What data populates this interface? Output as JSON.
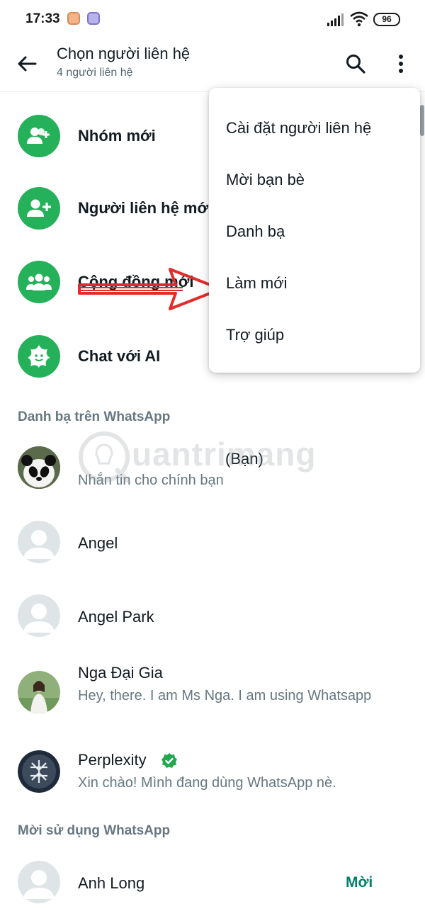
{
  "status_bar": {
    "time": "17:33",
    "battery": "96",
    "notification_icons": [
      "notification-app-icon",
      "viber-icon"
    ]
  },
  "header": {
    "title": "Chọn người liên hệ",
    "subtitle": "4 người liên hệ"
  },
  "actions": [
    {
      "label": "Nhóm mới",
      "icon": "new-group-icon"
    },
    {
      "label": "Người liên hệ mới",
      "icon": "add-contact-icon"
    },
    {
      "label": "Cộng đồng mới",
      "icon": "community-icon"
    },
    {
      "label": "Chat với AI",
      "icon": "ai-chat-icon"
    }
  ],
  "sections": {
    "whatsapp_contacts": "Danh bạ trên WhatsApp",
    "invite": "Mời sử dụng WhatsApp"
  },
  "contacts": [
    {
      "name": "(Bạn)",
      "status": "Nhắn tin cho chính bạn",
      "avatar": "panda-photo"
    },
    {
      "name": "Angel",
      "status": "",
      "avatar": "default"
    },
    {
      "name": "Angel Park",
      "status": "",
      "avatar": "default"
    },
    {
      "name": "Nga Đại Gia",
      "status": "Hey, there. I am Ms Nga. I am using Whatsapp",
      "avatar": "profile-photo"
    },
    {
      "name": "Perplexity",
      "status": "Xin chào! Mình đang dùng WhatsApp nè.",
      "avatar": "perplexity-logo",
      "verified": true
    }
  ],
  "invite_contacts": [
    {
      "name": "Anh Long",
      "action": "Mời"
    }
  ],
  "menu": {
    "items": [
      "Cài đặt người liên hệ",
      "Mời bạn bè",
      "Danh bạ",
      "Làm mới",
      "Trợ giúp"
    ]
  },
  "watermark": "uantrimang",
  "colors": {
    "accent": "#25b05a",
    "invite": "#008069",
    "annotation_arrow": "#e32b2b"
  }
}
